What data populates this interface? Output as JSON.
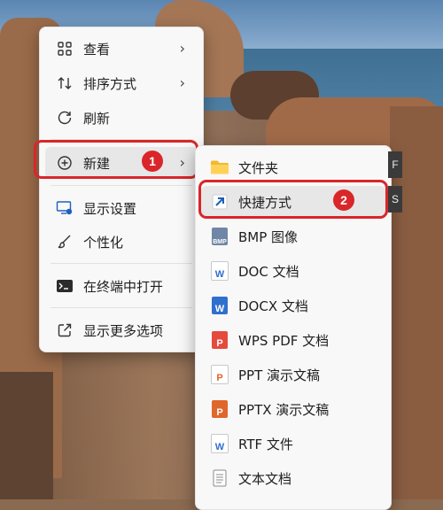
{
  "main_menu": {
    "items": [
      {
        "label": "查看",
        "icon": "grid-view-icon"
      },
      {
        "label": "排序方式",
        "icon": "sort-icon"
      },
      {
        "label": "刷新",
        "icon": "refresh-icon"
      },
      {
        "label": "新建",
        "icon": "plus-circle-icon"
      },
      {
        "label": "显示设置",
        "icon": "display-settings-icon"
      },
      {
        "label": "个性化",
        "icon": "brush-icon"
      },
      {
        "label": "在终端中打开",
        "icon": "terminal-icon"
      },
      {
        "label": "显示更多选项",
        "icon": "open-external-icon"
      }
    ]
  },
  "sub_menu": {
    "items": [
      {
        "label": "文件夹",
        "icon": "folder-icon"
      },
      {
        "label": "快捷方式",
        "icon": "shortcut-arrow-icon"
      },
      {
        "label": "BMP 图像",
        "icon": "bmp-file-icon"
      },
      {
        "label": "DOC 文档",
        "icon": "doc-file-icon"
      },
      {
        "label": "DOCX 文档",
        "icon": "docx-file-icon"
      },
      {
        "label": "WPS PDF 文档",
        "icon": "pdf-file-icon"
      },
      {
        "label": "PPT 演示文稿",
        "icon": "ppt-file-icon"
      },
      {
        "label": "PPTX 演示文稿",
        "icon": "pptx-file-icon"
      },
      {
        "label": "RTF 文件",
        "icon": "rtf-file-icon"
      },
      {
        "label": "文本文档",
        "icon": "text-file-icon"
      }
    ]
  },
  "badges": {
    "step1": "1",
    "step2": "2"
  },
  "key_hints": {
    "folder": "F",
    "shortcut": "S"
  },
  "icon_glyphs": {
    "bmp": "BMP",
    "doc": "W",
    "pdf": "P",
    "ppt": "P",
    "rtf": "W"
  },
  "colors": {
    "highlight_outline": "#d9262a",
    "menu_bg": "#f8f8f8"
  }
}
